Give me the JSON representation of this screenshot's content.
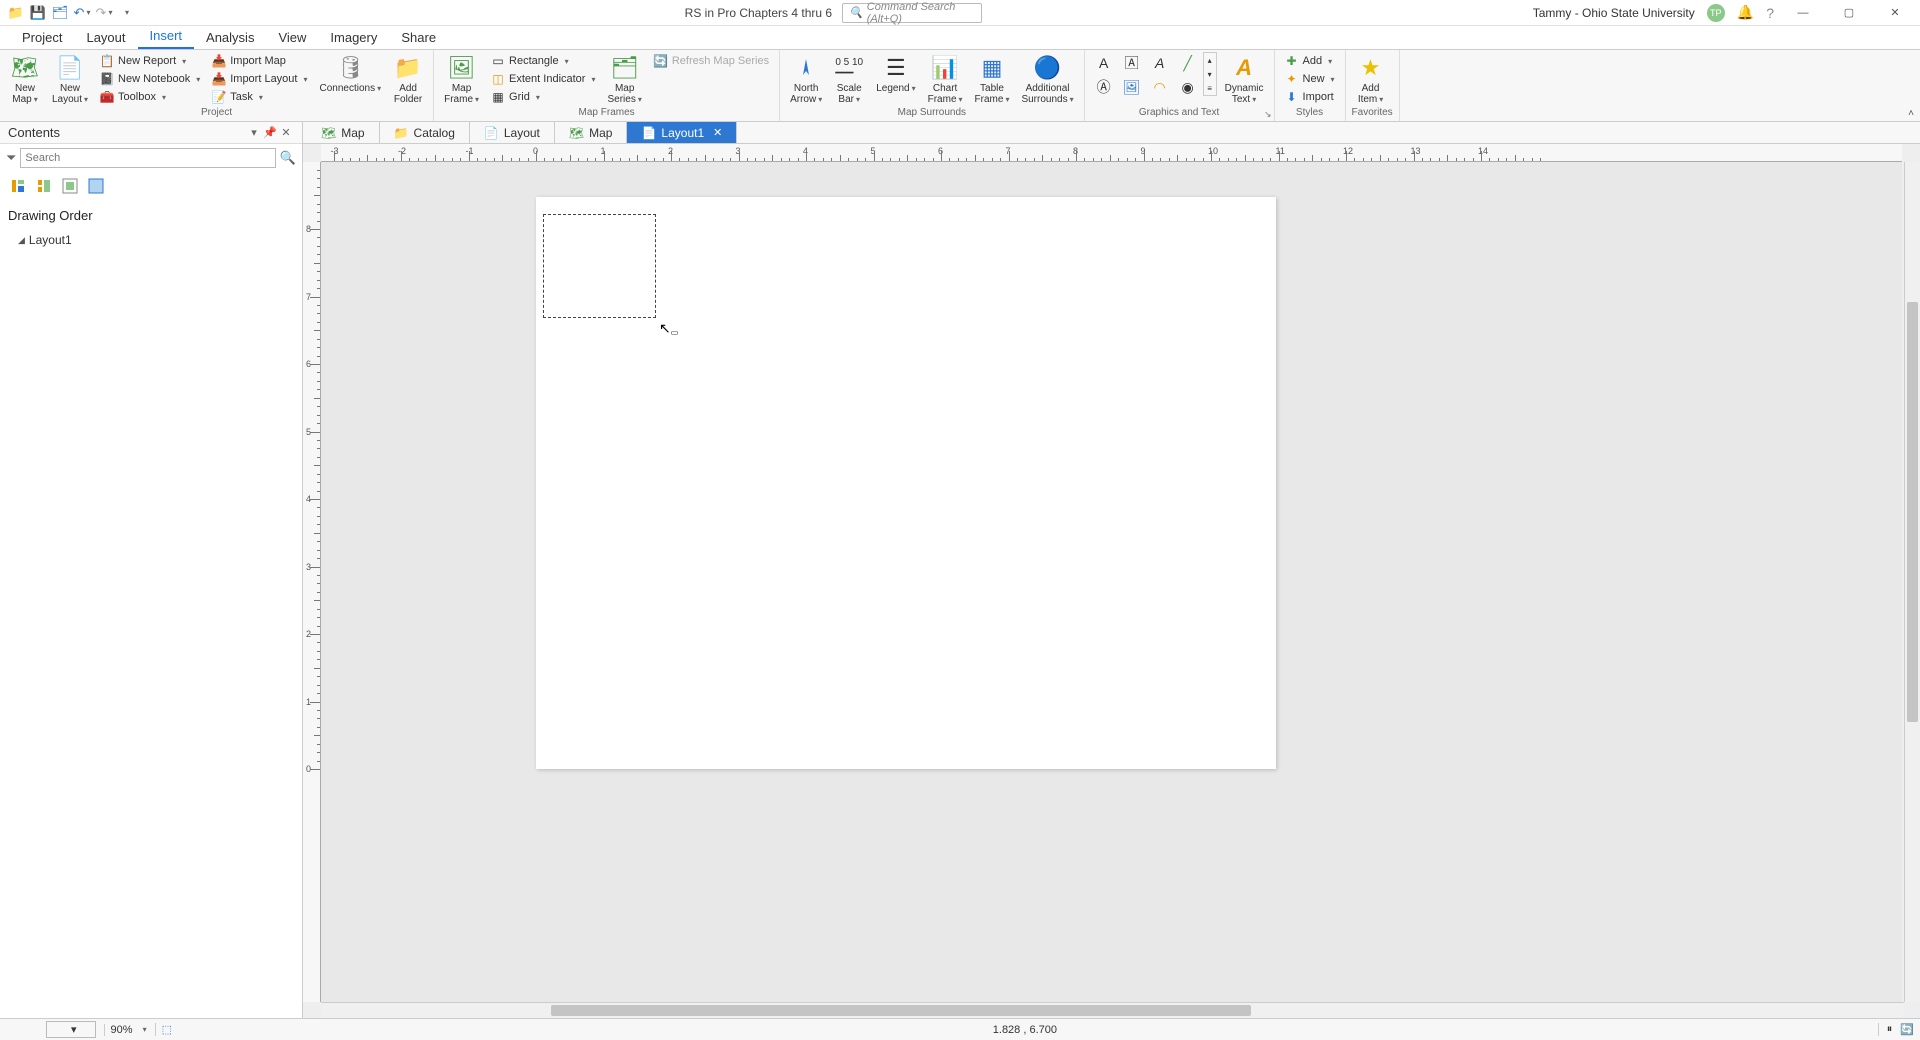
{
  "title": "RS in Pro Chapters 4 thru 6",
  "cmd_search_placeholder": "Command Search (Alt+Q)",
  "user_name": "Tammy - Ohio State University",
  "user_initials": "TP",
  "ribbon_tabs": [
    "Project",
    "Layout",
    "Insert",
    "Analysis",
    "View",
    "Imagery",
    "Share"
  ],
  "active_tab_index": 2,
  "groups": {
    "project": {
      "label": "Project",
      "new_map": "New\nMap",
      "new_layout": "New\nLayout",
      "new_report": "New Report",
      "new_notebook": "New Notebook",
      "toolbox": "Toolbox",
      "import_map": "Import Map",
      "import_layout": "Import Layout",
      "task": "Task",
      "connections": "Connections",
      "add_folder": "Add\nFolder"
    },
    "mapframes": {
      "label": "Map Frames",
      "map_frame": "Map\nFrame",
      "rectangle": "Rectangle",
      "extent_indicator": "Extent Indicator",
      "grid": "Grid",
      "map_series": "Map\nSeries",
      "refresh_map_series": "Refresh Map Series"
    },
    "surrounds": {
      "label": "Map Surrounds",
      "north_arrow": "North\nArrow",
      "scale_bar": "Scale\nBar",
      "legend": "Legend",
      "chart_frame": "Chart\nFrame",
      "table_frame": "Table\nFrame",
      "additional_surrounds": "Additional\nSurrounds"
    },
    "graphics_text": {
      "label": "Graphics and Text",
      "dynamic_text": "Dynamic\nText"
    },
    "styles": {
      "label": "Styles",
      "add": "Add",
      "new": "New",
      "import": "Import"
    },
    "favorites": {
      "label": "Favorites",
      "add_item": "Add\nItem"
    }
  },
  "contents": {
    "title": "Contents",
    "search_placeholder": "Search",
    "drawing_order": "Drawing Order",
    "layout_item": "Layout1"
  },
  "view_tabs": [
    {
      "label": "Map",
      "icon": "map"
    },
    {
      "label": "Catalog",
      "icon": "catalog"
    },
    {
      "label": "Layout",
      "icon": "layout"
    },
    {
      "label": "Map",
      "icon": "map"
    },
    {
      "label": "Layout1",
      "icon": "layout",
      "active": true,
      "closable": true
    }
  ],
  "status": {
    "zoom": "90%",
    "coords": "1.828 , 6.700"
  }
}
